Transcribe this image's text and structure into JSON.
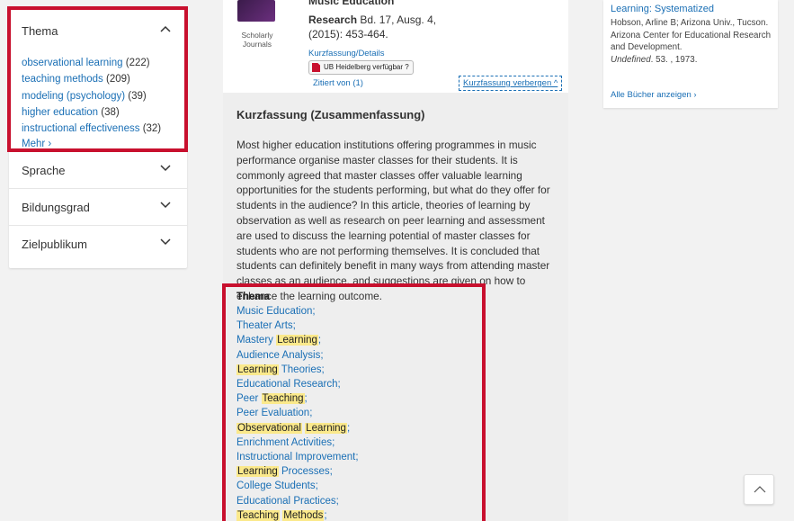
{
  "facets": {
    "thema": {
      "title": "Thema",
      "items": [
        {
          "label": "observational learning",
          "count": "(222)"
        },
        {
          "label": "teaching methods",
          "count": "(209)"
        },
        {
          "label": "modeling (psychology)",
          "count": "(39)"
        },
        {
          "label": "higher education",
          "count": "(38)"
        },
        {
          "label": "instructional effectiveness",
          "count": "(32)"
        }
      ],
      "more": "Mehr ›"
    },
    "sprache": {
      "title": "Sprache"
    },
    "bildungsgrad": {
      "title": "Bildungsgrad"
    },
    "zielpublikum": {
      "title": "Zielpublikum"
    }
  },
  "record": {
    "journal_title": "Music Education",
    "source_name": "Research",
    "source_rest": " Bd. 17, Ausg. 4,",
    "pages": "(2015): 453-464.",
    "type_label": "Scholarly Journals",
    "details_link": "Kurzfassung/Details",
    "availability": "UB Heidelberg verfügbar ?",
    "cited": "Zitiert von (1)",
    "hide_abstract": "Kurzfassung verbergen ^"
  },
  "abstract": {
    "heading": "Kurzfassung (Zusammenfassung)",
    "text": "Most higher education institutions offering programmes in music performance organise master classes for their students. It is commonly agreed that master classes offer valuable learning opportunities for the students performing, but what do they offer for students in the audience? In this article, theories of learning by observation as well as research on peer learning and assessment are used to discuss the learning potential of master classes for students who are not performing themselves. It is concluded that students can definitely benefit in many ways from attending master classes as an audience, and suggestions are given on how to enhance the learning outcome."
  },
  "subjects": {
    "title": "Thema",
    "items": [
      "Music Education;",
      "Theater Arts;",
      "Mastery Learning;",
      "Audience Analysis;",
      "Learning Theories;",
      "Educational Research;",
      "Peer Teaching;",
      "Peer Evaluation;",
      "Observational Learning;",
      "Enrichment Activities;",
      "Instructional Improvement;",
      "Learning Processes;",
      "College Students;",
      "Educational Practices;",
      "Teaching Methods;"
    ]
  },
  "related": {
    "title": "Learning: Systematized",
    "authors": "Hobson, Arline B; Arizona Univ., Tucson. Arizona Center for Educational Research and Development.",
    "status": "Undefined",
    "year": "53. , 1973.",
    "all_books": "Alle Bücher anzeigen ›"
  },
  "colors": {
    "accent": "#1a6fb5",
    "highlight_border": "#c8102e",
    "term_highlight": "#fbe98b"
  }
}
